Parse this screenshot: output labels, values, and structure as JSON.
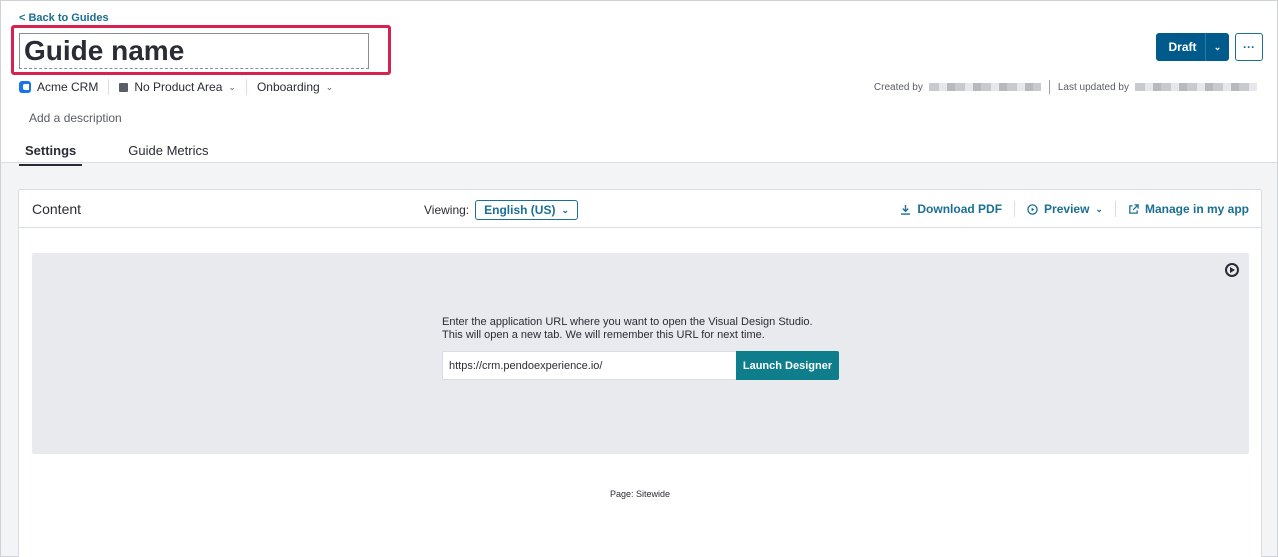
{
  "header": {
    "back_label": "< Back to Guides",
    "guide_name": "Guide name",
    "meta": {
      "app_name": "Acme CRM",
      "product_area": "No Product Area",
      "group": "Onboarding"
    },
    "description_placeholder": "Add a description",
    "created_by_label": "Created by",
    "last_updated_label": "Last updated by",
    "status_label": "Draft",
    "more_label": "···"
  },
  "tabs": [
    {
      "label": "Settings",
      "active": true
    },
    {
      "label": "Guide Metrics",
      "active": false
    }
  ],
  "content": {
    "title": "Content",
    "viewing_label": "Viewing:",
    "language": "English (US)",
    "actions": {
      "download": "Download PDF",
      "preview": "Preview",
      "manage": "Manage in my app"
    },
    "instructions_line1": "Enter the application URL where you want to open the Visual Design Studio.",
    "instructions_line2": "This will open a new tab. We will remember this URL for next time.",
    "url_value": "https://crm.pendoexperience.io/",
    "launch_label": "Launch Designer",
    "page_label": "Page: Sitewide"
  },
  "colors": {
    "accent": "#1a6f93",
    "primary_button": "#005a8b",
    "launch_button": "#0e7d8c",
    "highlight": "#d6224e"
  },
  "icons": [
    "app-logo-icon",
    "product-area-icon",
    "chevron-down-icon",
    "download-icon",
    "play-circle-icon",
    "external-link-icon"
  ]
}
